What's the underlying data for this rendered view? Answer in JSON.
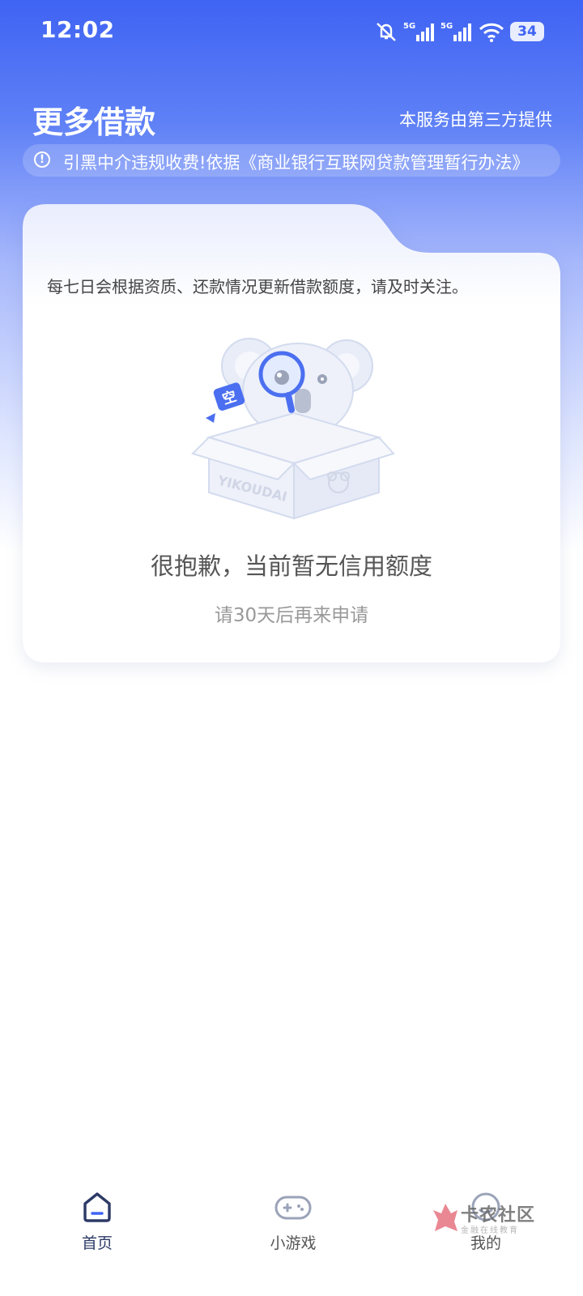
{
  "status_bar": {
    "time": "12:02",
    "network_1": "5G",
    "network_2": "5G",
    "battery": "34"
  },
  "header": {
    "title": "更多借款",
    "provider_note": "本服务由第三方提供"
  },
  "notice": {
    "text": "引黑中介违规收费!依据《商业银行互联网贷款管理暂行办法》"
  },
  "card": {
    "description": "每七日会根据资质、还款情况更新借款额度，请及时关注。",
    "empty_title": "很抱歉，当前暂无信用额度",
    "empty_subtitle": "请30天后再来申请",
    "illustration": {
      "badge_text": "空",
      "box_text": "YIKOUDAI"
    }
  },
  "bottom_nav": {
    "items": [
      {
        "label": "首页",
        "icon": "home-icon",
        "active": true
      },
      {
        "label": "小游戏",
        "icon": "gamepad-icon",
        "active": false
      },
      {
        "label": "我的",
        "icon": "profile-icon",
        "active": false
      }
    ]
  },
  "watermark": {
    "text": "卡农社区",
    "sub": "金融在线教育"
  },
  "colors": {
    "brand_blue": "#3f63f4",
    "nav_active": "#2d3a66"
  }
}
